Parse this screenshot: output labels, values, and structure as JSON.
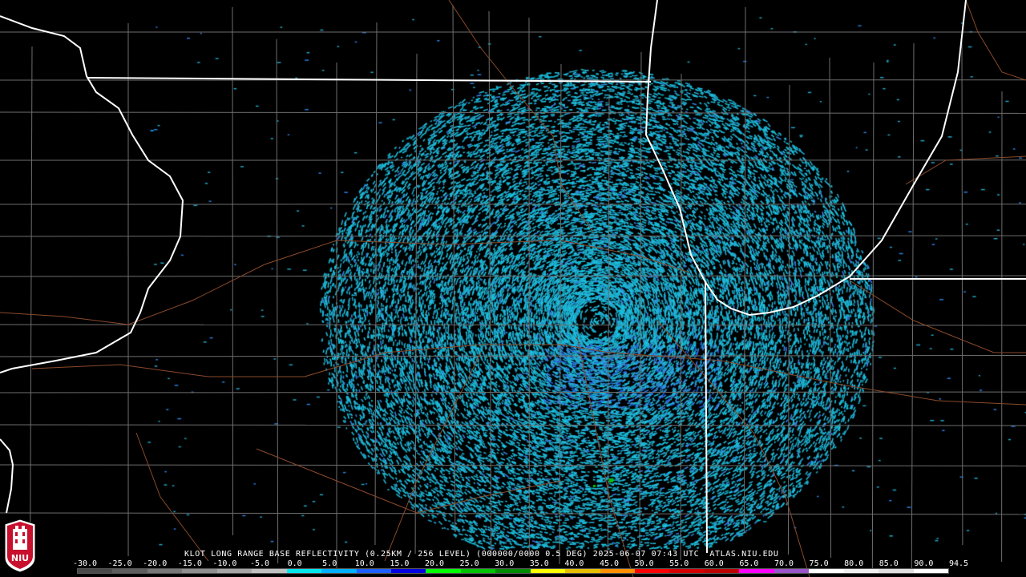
{
  "product": {
    "caption": "KLOT LONG RANGE BASE REFLECTIVITY (0.25KM / 256 LEVEL) (000000/0000 0.5 DEG) 2025-06-07 07:43 UTC  ATLAS.NIU.EDU"
  },
  "logo": {
    "text": "NIU",
    "color": "#c8102e"
  },
  "scale": {
    "labels": [
      "-30.0",
      "-25.0",
      "-20.0",
      "-15.0",
      "-10.0",
      "-5.0",
      "0.0",
      "5.0",
      "10.0",
      "15.0",
      "20.0",
      "25.0",
      "30.0",
      "35.0",
      "40.0",
      "45.0",
      "50.0",
      "55.0",
      "60.0",
      "65.0",
      "70.0",
      "75.0",
      "80.0",
      "85.0",
      "90.0",
      "94.5"
    ],
    "colors": [
      "#4a4a4a",
      "#5e5e5e",
      "#777777",
      "#8f8f8f",
      "#a6a6a6",
      "#c0c0c0",
      "#00e5ee",
      "#00b0ff",
      "#1e60ff",
      "#0000e0",
      "#00ff00",
      "#00c400",
      "#008c00",
      "#ffff00",
      "#e6c000",
      "#ff9000",
      "#ff0000",
      "#d40000",
      "#bc0000",
      "#ff00ff",
      "#9a55c9",
      "#ffffff",
      "#f0f0f0",
      "#e0e0e0",
      "#ffffff"
    ]
  },
  "map": {
    "radar_site": "KLOT",
    "colors": {
      "state": "#ffffff",
      "county": "#6e6e6e",
      "road": "#8b4a2b",
      "echo": "#1ea6c8"
    }
  }
}
